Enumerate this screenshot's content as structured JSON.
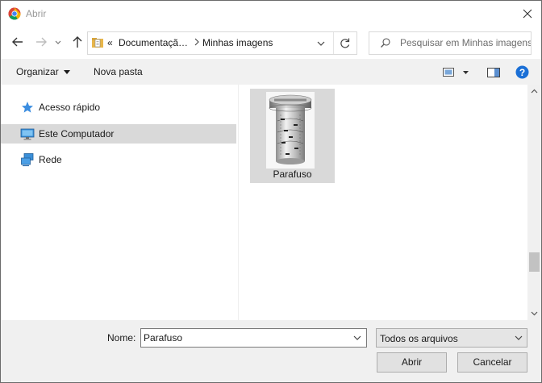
{
  "window": {
    "title": "Abrir"
  },
  "address": {
    "crumbs": [
      "Documentaçã…",
      "Minhas imagens"
    ],
    "overflow_glyph": "«"
  },
  "search": {
    "placeholder": "Pesquisar em Minhas imagens"
  },
  "toolbar": {
    "organize_label": "Organizar",
    "new_folder_label": "Nova pasta"
  },
  "nav_pane": {
    "items": [
      {
        "label": "Acesso rápido",
        "icon": "star-icon",
        "selected": false
      },
      {
        "label": "Este Computador",
        "icon": "computer-icon",
        "selected": true
      },
      {
        "label": "Rede",
        "icon": "network-icon",
        "selected": false
      }
    ]
  },
  "files": [
    {
      "name": "Parafuso",
      "selected": true,
      "thumbnail": "screw-technical-drawing"
    }
  ],
  "bottom": {
    "name_label": "Nome:",
    "name_value": "Parafuso",
    "filetype_label": "Todos os arquivos",
    "open_label": "Abrir",
    "cancel_label": "Cancelar"
  },
  "colors": {
    "selection": "#d9d9d9",
    "help_blue": "#1a6fd6",
    "command_bar": "#f1f1f1",
    "bottom_panel": "#f0f0f0"
  }
}
